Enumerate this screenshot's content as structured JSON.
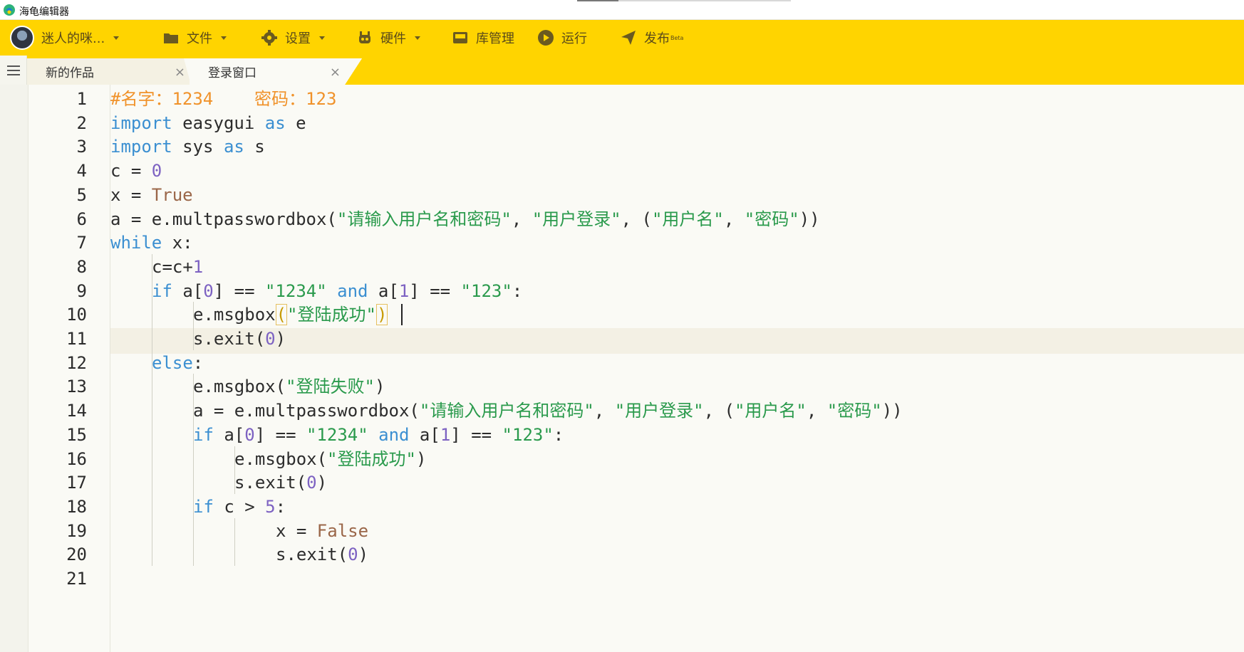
{
  "window": {
    "title": "海龟编辑器"
  },
  "toolbar": {
    "user_name": "迷人的咪...",
    "file": "文件",
    "settings": "设置",
    "hardware": "硬件",
    "library": "库管理",
    "run": "运行",
    "publish": "发布",
    "publish_badge": "Beta",
    "bg_color": "#ffd400"
  },
  "tabs": [
    {
      "label": "新的作品",
      "close": "×",
      "active": false
    },
    {
      "label": "登录窗口",
      "close": "×",
      "active": true
    }
  ],
  "editor": {
    "active_line": 10,
    "line_numbers": [
      "1",
      "2",
      "3",
      "4",
      "5",
      "6",
      "7",
      "8",
      "9",
      "10",
      "11",
      "12",
      "13",
      "14",
      "15",
      "16",
      "17",
      "18",
      "19",
      "20",
      "21"
    ],
    "lines": [
      {
        "indent": 0,
        "tokens": [
          {
            "t": "#名字：1234    密码：123",
            "c": "cmt"
          }
        ]
      },
      {
        "indent": 0,
        "tokens": [
          {
            "t": "import",
            "c": "kw"
          },
          {
            "t": " easygui "
          },
          {
            "t": "as",
            "c": "kw"
          },
          {
            "t": " e"
          }
        ]
      },
      {
        "indent": 0,
        "tokens": [
          {
            "t": "import",
            "c": "kw"
          },
          {
            "t": " sys "
          },
          {
            "t": "as",
            "c": "kw"
          },
          {
            "t": " s"
          }
        ]
      },
      {
        "indent": 0,
        "tokens": [
          {
            "t": "c = "
          },
          {
            "t": "0",
            "c": "num"
          }
        ]
      },
      {
        "indent": 0,
        "tokens": [
          {
            "t": "x = "
          },
          {
            "t": "True",
            "c": "const"
          }
        ]
      },
      {
        "indent": 0,
        "tokens": [
          {
            "t": "a = e.multpasswordbox("
          },
          {
            "t": "\"请输入用户名和密码\"",
            "c": "str"
          },
          {
            "t": ", "
          },
          {
            "t": "\"用户登录\"",
            "c": "str"
          },
          {
            "t": ", ("
          },
          {
            "t": "\"用户名\"",
            "c": "str"
          },
          {
            "t": ", "
          },
          {
            "t": "\"密码\"",
            "c": "str"
          },
          {
            "t": "))"
          }
        ]
      },
      {
        "indent": 0,
        "tokens": [
          {
            "t": "while",
            "c": "kw"
          },
          {
            "t": " x:"
          }
        ]
      },
      {
        "indent": 1,
        "tokens": [
          {
            "t": "c=c+"
          },
          {
            "t": "1",
            "c": "num"
          }
        ]
      },
      {
        "indent": 1,
        "tokens": [
          {
            "t": "if",
            "c": "kw"
          },
          {
            "t": " a["
          },
          {
            "t": "0",
            "c": "num"
          },
          {
            "t": "] == "
          },
          {
            "t": "\"1234\"",
            "c": "str"
          },
          {
            "t": " "
          },
          {
            "t": "and",
            "c": "kw"
          },
          {
            "t": " a["
          },
          {
            "t": "1",
            "c": "num"
          },
          {
            "t": "] == "
          },
          {
            "t": "\"123\"",
            "c": "str"
          },
          {
            "t": ":"
          }
        ]
      },
      {
        "indent": 2,
        "tokens": [
          {
            "t": "e.msgbox"
          },
          {
            "t": "(",
            "c": "hl-paren"
          },
          {
            "t": "\"登陆成功\"",
            "c": "str"
          },
          {
            "t": ")",
            "c": "hl-paren"
          }
        ]
      },
      {
        "indent": 2,
        "tokens": [
          {
            "t": "s.exit("
          },
          {
            "t": "0",
            "c": "num"
          },
          {
            "t": ")"
          }
        ]
      },
      {
        "indent": 1,
        "tokens": [
          {
            "t": "else",
            "c": "kw"
          },
          {
            "t": ":"
          }
        ]
      },
      {
        "indent": 2,
        "tokens": [
          {
            "t": "e.msgbox("
          },
          {
            "t": "\"登陆失败\"",
            "c": "str"
          },
          {
            "t": ")"
          }
        ]
      },
      {
        "indent": 2,
        "tokens": [
          {
            "t": "a = e.multpasswordbox("
          },
          {
            "t": "\"请输入用户名和密码\"",
            "c": "str"
          },
          {
            "t": ", "
          },
          {
            "t": "\"用户登录\"",
            "c": "str"
          },
          {
            "t": ", ("
          },
          {
            "t": "\"用户名\"",
            "c": "str"
          },
          {
            "t": ", "
          },
          {
            "t": "\"密码\"",
            "c": "str"
          },
          {
            "t": "))"
          }
        ]
      },
      {
        "indent": 2,
        "tokens": [
          {
            "t": "if",
            "c": "kw"
          },
          {
            "t": " a["
          },
          {
            "t": "0",
            "c": "num"
          },
          {
            "t": "] == "
          },
          {
            "t": "\"1234\"",
            "c": "str"
          },
          {
            "t": " "
          },
          {
            "t": "and",
            "c": "kw"
          },
          {
            "t": " a["
          },
          {
            "t": "1",
            "c": "num"
          },
          {
            "t": "] == "
          },
          {
            "t": "\"123\"",
            "c": "str"
          },
          {
            "t": ":"
          }
        ]
      },
      {
        "indent": 3,
        "tokens": [
          {
            "t": "e.msgbox("
          },
          {
            "t": "\"登陆成功\"",
            "c": "str"
          },
          {
            "t": ")"
          }
        ]
      },
      {
        "indent": 3,
        "tokens": [
          {
            "t": "s.exit("
          },
          {
            "t": "0",
            "c": "num"
          },
          {
            "t": ")"
          }
        ]
      },
      {
        "indent": 2,
        "tokens": [
          {
            "t": "if",
            "c": "kw"
          },
          {
            "t": " c > "
          },
          {
            "t": "5",
            "c": "num"
          },
          {
            "t": ":"
          }
        ]
      },
      {
        "indent": 4,
        "tokens": [
          {
            "t": "x = "
          },
          {
            "t": "False",
            "c": "const"
          }
        ]
      },
      {
        "indent": 4,
        "tokens": [
          {
            "t": "s.exit("
          },
          {
            "t": "0",
            "c": "num"
          },
          {
            "t": ")"
          }
        ]
      },
      {
        "indent": 0,
        "tokens": []
      }
    ]
  }
}
